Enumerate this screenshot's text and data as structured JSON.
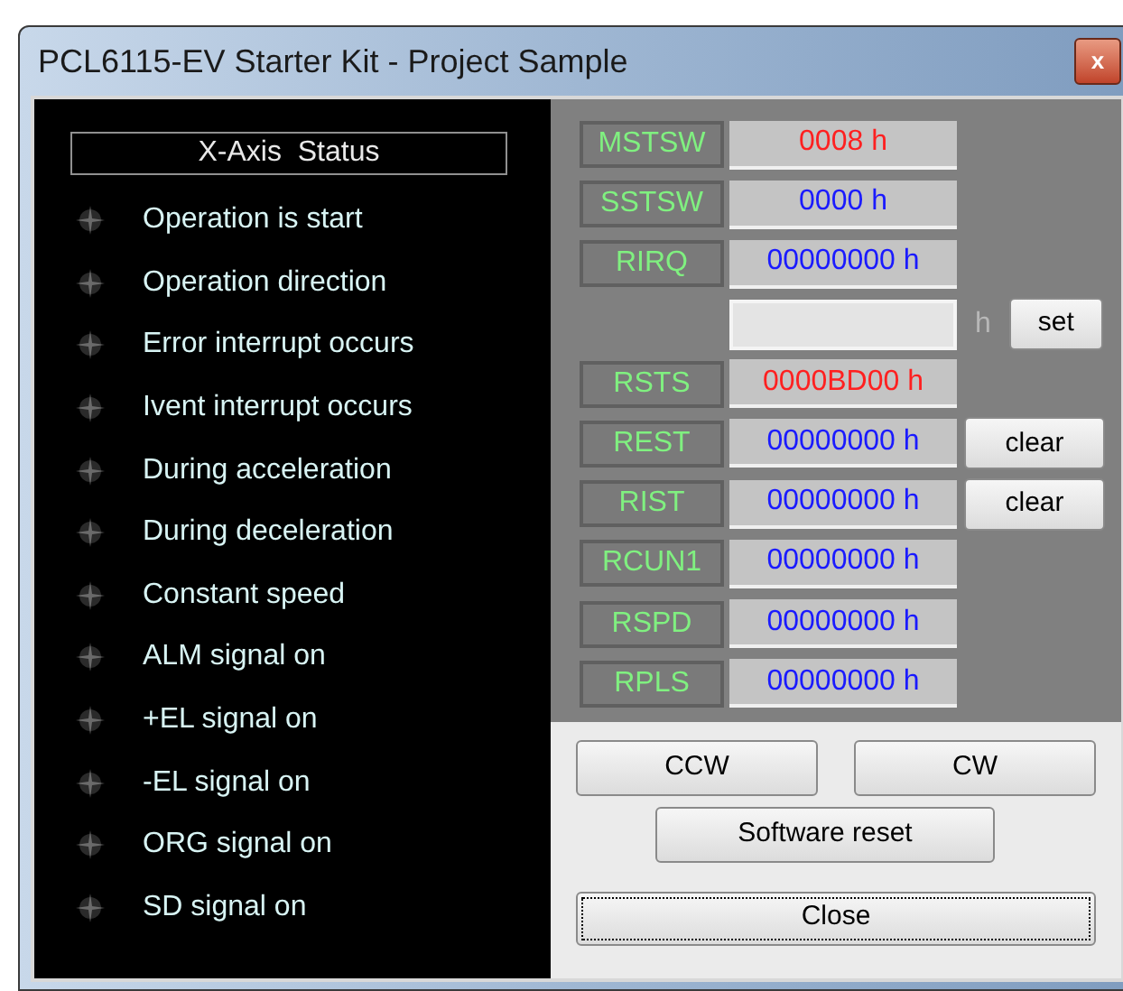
{
  "window": {
    "title": "PCL6115-EV Starter Kit - Project Sample",
    "close": "x"
  },
  "status": {
    "title": "X-Axis  Status",
    "items": [
      {
        "label": "Operation is start",
        "on": false
      },
      {
        "label": "Operation direction",
        "on": false
      },
      {
        "label": "Error interrupt occurs",
        "on": false
      },
      {
        "label": "Ivent interrupt occurs",
        "on": false
      },
      {
        "label": "During acceleration",
        "on": false
      },
      {
        "label": "During deceleration",
        "on": false
      },
      {
        "label": "Constant speed",
        "on": false
      },
      {
        "label": "ALM signal on",
        "on": false
      },
      {
        "label": "+EL signal on",
        "on": false
      },
      {
        "label": "-EL signal on",
        "on": false
      },
      {
        "label": "ORG signal on",
        "on": false
      },
      {
        "label": "SD signal on",
        "on": false
      }
    ]
  },
  "registers": [
    {
      "kind": "register",
      "label": "MSTSW",
      "value": "0008 h",
      "color": "#ff2020"
    },
    {
      "kind": "register",
      "label": "SSTSW",
      "value": "0000 h",
      "color": "#1a1aff"
    },
    {
      "kind": "register",
      "label": "RIRQ",
      "value": "00000000 h",
      "color": "#1a1aff"
    },
    {
      "kind": "input",
      "unit": "h",
      "button": "set"
    },
    {
      "kind": "register",
      "label": "RSTS",
      "value": "0000BD00 h",
      "color": "#ff2020"
    },
    {
      "kind": "register",
      "label": "REST",
      "value": "00000000 h",
      "color": "#1a1aff",
      "button": "clear"
    },
    {
      "kind": "register",
      "label": "RIST",
      "value": "00000000 h",
      "color": "#1a1aff",
      "button": "clear"
    },
    {
      "kind": "register",
      "label": "RCUN1",
      "value": "00000000 h",
      "color": "#1a1aff"
    },
    {
      "kind": "register",
      "label": "RSPD",
      "value": "00000000 h",
      "color": "#1a1aff"
    },
    {
      "kind": "register",
      "label": "RPLS",
      "value": "00000000 h",
      "color": "#1a1aff"
    }
  ],
  "buttons": {
    "ccw": "CCW",
    "cw": "CW",
    "reset": "Software reset",
    "close": "Close"
  }
}
